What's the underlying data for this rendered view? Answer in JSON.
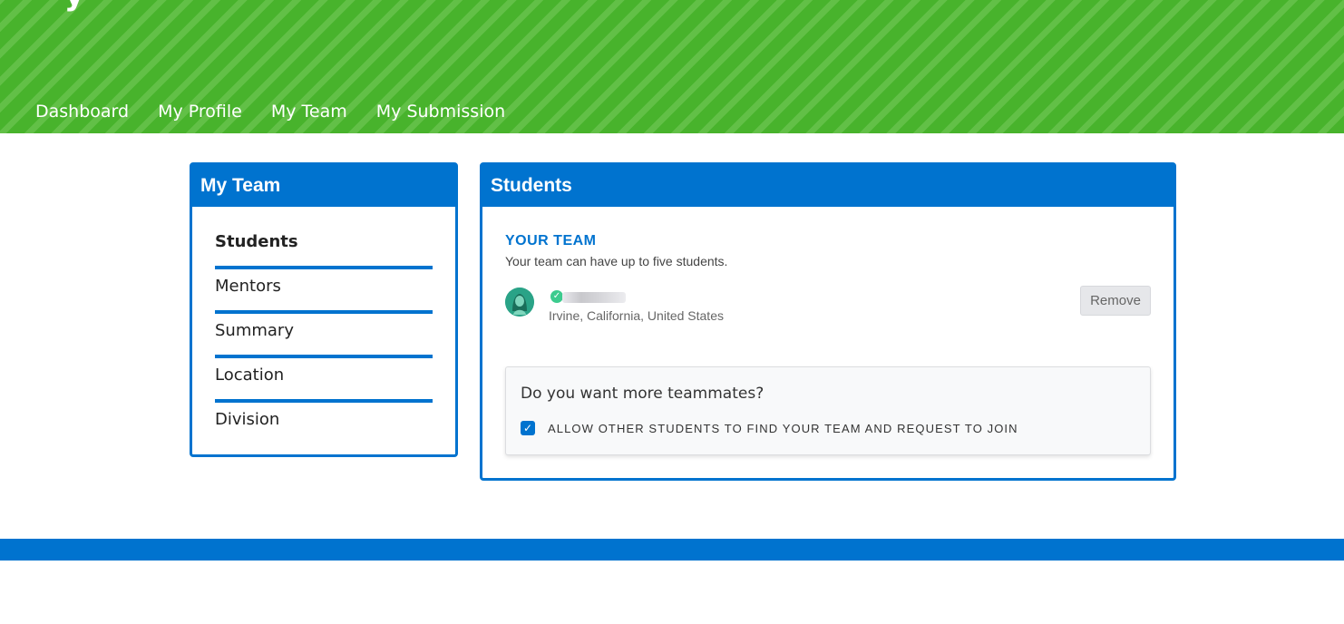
{
  "header": {
    "title_fragment": "˙ y · ˙ ",
    "background_color": "#48b32c",
    "nav": [
      {
        "label": "Dashboard"
      },
      {
        "label": "My Profile"
      },
      {
        "label": "My Team"
      },
      {
        "label": "My Submission"
      }
    ]
  },
  "sidebar": {
    "title": "My Team",
    "items": [
      {
        "label": "Students",
        "active": true
      },
      {
        "label": "Mentors",
        "active": false
      },
      {
        "label": "Summary",
        "active": false
      },
      {
        "label": "Location",
        "active": false
      },
      {
        "label": "Division",
        "active": false
      }
    ]
  },
  "main": {
    "title": "Students",
    "team_heading": "YOUR TEAM",
    "team_subtitle": "Your team can have up to five students.",
    "member": {
      "avatar_icon": "student-avatar-icon",
      "verified_icon": "check-circle-icon",
      "location": "Irvine, California, United States",
      "remove_label": "Remove"
    },
    "more_teammates": {
      "question": "Do you want more teammates?",
      "checkbox_checked": true,
      "checkbox_label": "ALLOW OTHER STUDENTS TO FIND YOUR TEAM AND REQUEST TO JOIN"
    }
  },
  "colors": {
    "primary_blue": "#0073cf",
    "header_green": "#48b32c",
    "verified_green": "#3ccb8e"
  }
}
